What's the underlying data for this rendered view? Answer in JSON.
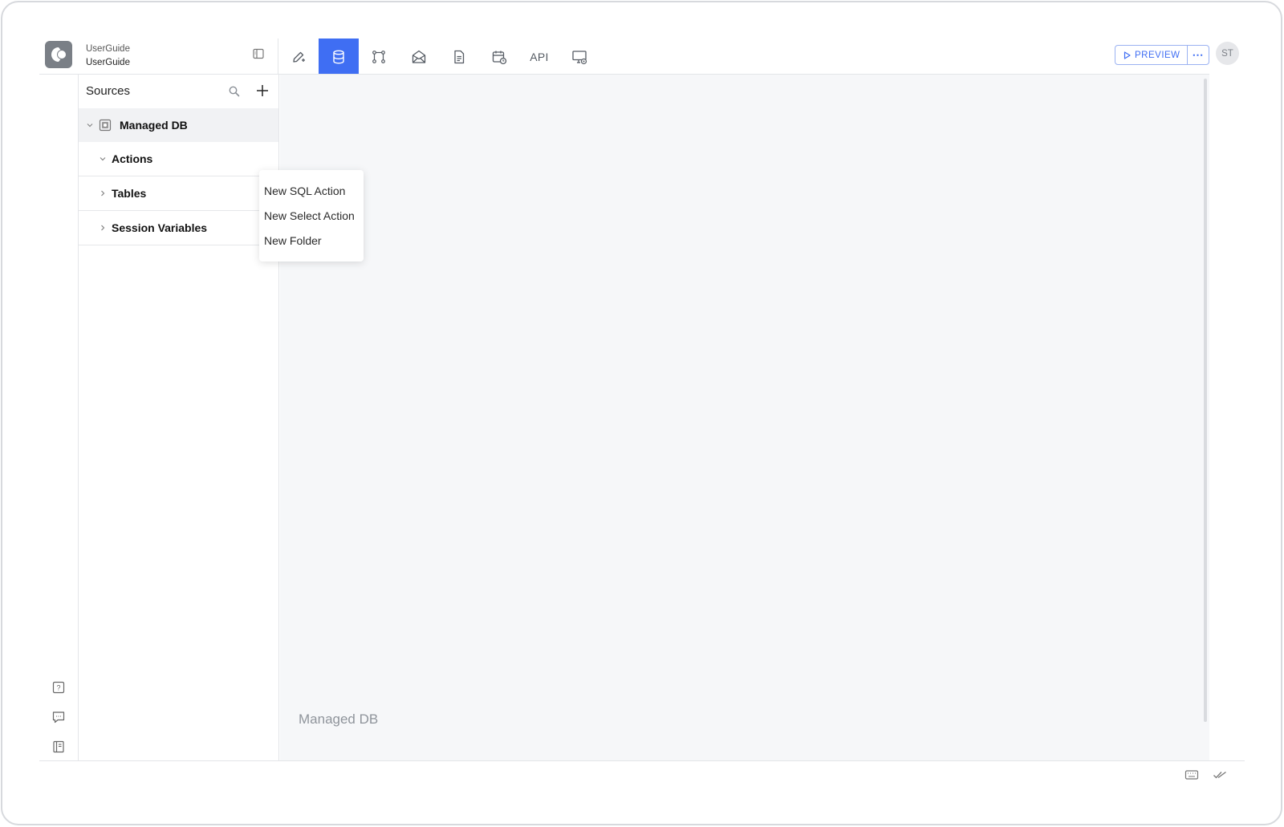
{
  "project": {
    "line1": "UserGuide",
    "line2": "UserGuide"
  },
  "topnav": [
    {
      "name": "edit-pages-tab",
      "icon": "pencil-plus-icon"
    },
    {
      "name": "data-tab",
      "icon": "database-icon",
      "active": true
    },
    {
      "name": "flows-tab",
      "icon": "flow-icon"
    },
    {
      "name": "email-tab",
      "icon": "envelope-open-icon"
    },
    {
      "name": "documents-tab",
      "icon": "document-icon"
    },
    {
      "name": "scheduler-tab",
      "icon": "calendar-clock-icon"
    },
    {
      "name": "api-tab",
      "label": "API"
    },
    {
      "name": "settings-tab",
      "icon": "monitor-gear-icon"
    }
  ],
  "header": {
    "preview_label": "PREVIEW",
    "more_label": "⋯",
    "avatar_initials": "ST"
  },
  "sources": {
    "title": "Sources",
    "db_name": "Managed DB",
    "items": [
      {
        "label": "Actions",
        "expanded": true
      },
      {
        "label": "Tables",
        "expanded": false
      },
      {
        "label": "Session Variables",
        "expanded": false
      }
    ]
  },
  "context_menu": {
    "items": [
      "New SQL Action",
      "New Select Action",
      "New Folder"
    ]
  },
  "canvas": {
    "label": "Managed DB"
  },
  "colors": {
    "accent": "#3f6ef3",
    "canvas_bg": "#f6f7f9"
  }
}
